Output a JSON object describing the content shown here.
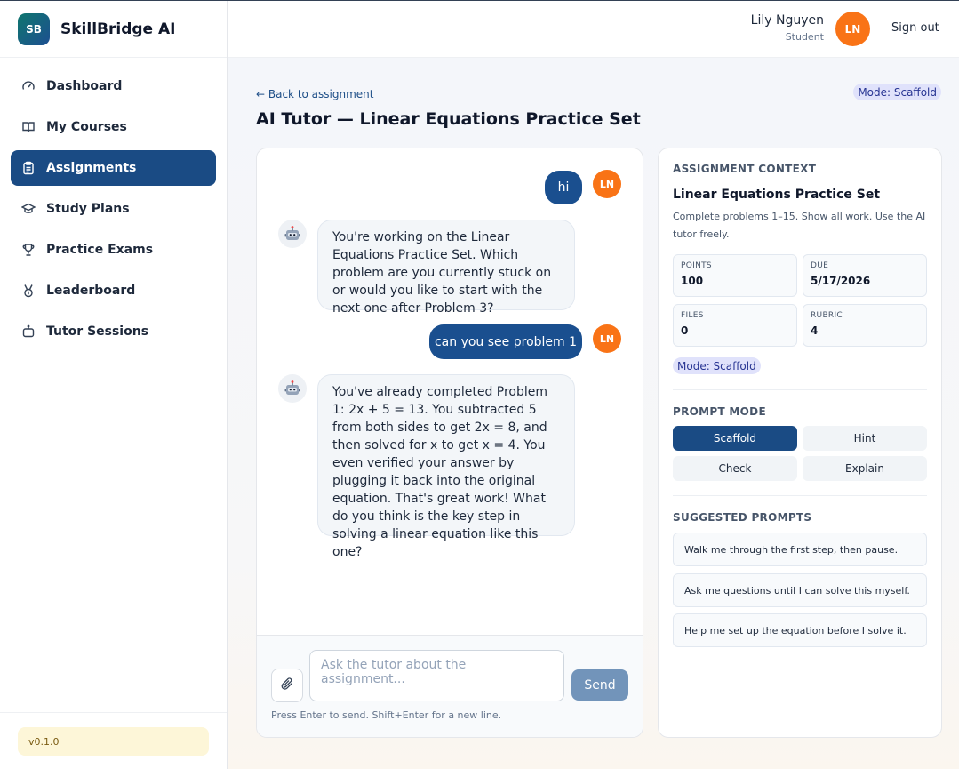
{
  "brand": {
    "logo_text": "SB",
    "name": "SkillBridge AI"
  },
  "sidebar": {
    "items": [
      {
        "label": "Dashboard",
        "icon": "gauge-icon"
      },
      {
        "label": "My Courses",
        "icon": "book-icon"
      },
      {
        "label": "Assignments",
        "icon": "clipboard-icon",
        "active": true
      },
      {
        "label": "Study Plans",
        "icon": "graduation-cap-icon"
      },
      {
        "label": "Practice Exams",
        "icon": "trophy-icon"
      },
      {
        "label": "Leaderboard",
        "icon": "medal-icon"
      },
      {
        "label": "Tutor Sessions",
        "icon": "bot-icon"
      }
    ],
    "version": "v0.1.0"
  },
  "header": {
    "user_name": "Lily Nguyen",
    "user_role": "Student",
    "user_initials": "LN",
    "sign_out": "Sign out"
  },
  "page": {
    "back_link": "← Back to assignment",
    "mode_badge": "Mode: Scaffold",
    "title": "AI Tutor — Linear Equations Practice Set"
  },
  "chat": {
    "messages": [
      {
        "role": "user",
        "text": "hi"
      },
      {
        "role": "assistant",
        "text": "You're working on the Linear Equations Practice Set. Which problem are you currently stuck on or would you like to start with the next one after Problem 3?"
      },
      {
        "role": "user",
        "text": "can you see problem 1"
      },
      {
        "role": "assistant",
        "text": "You've already completed Problem 1: 2x + 5 = 13. You subtracted 5 from both sides to get 2x = 8, and then solved for x to get x = 4. You even verified your answer by plugging it back into the original equation. That's great work! What do you think is the key step in solving a linear equation like this one?"
      }
    ],
    "input_value": "",
    "input_placeholder": "Ask the tutor about the assignment...",
    "send_label": "Send",
    "hint": "Press Enter to send. Shift+Enter for a new line."
  },
  "context": {
    "heading": "ASSIGNMENT CONTEXT",
    "title": "Linear Equations Practice Set",
    "description": "Complete problems 1–15. Show all work. Use the AI tutor freely.",
    "stats": [
      {
        "label": "POINTS",
        "value": "100"
      },
      {
        "label": "DUE",
        "value": "5/17/2026"
      },
      {
        "label": "FILES",
        "value": "0"
      },
      {
        "label": "RUBRIC",
        "value": "4"
      }
    ],
    "mode_badge": "Mode: Scaffold",
    "prompt_mode_heading": "PROMPT MODE",
    "modes": [
      {
        "label": "Scaffold",
        "active": true
      },
      {
        "label": "Hint"
      },
      {
        "label": "Check"
      },
      {
        "label": "Explain"
      }
    ],
    "suggested_heading": "SUGGESTED PROMPTS",
    "suggested": [
      "Walk me through the first step, then pause.",
      "Ask me questions until I can solve this myself.",
      "Help me set up the equation before I solve it."
    ]
  },
  "colors": {
    "primary": "#1a4b84",
    "avatar": "#f97316",
    "badge_bg": "#e0e2fb",
    "version_bg": "#fdf6d8"
  }
}
